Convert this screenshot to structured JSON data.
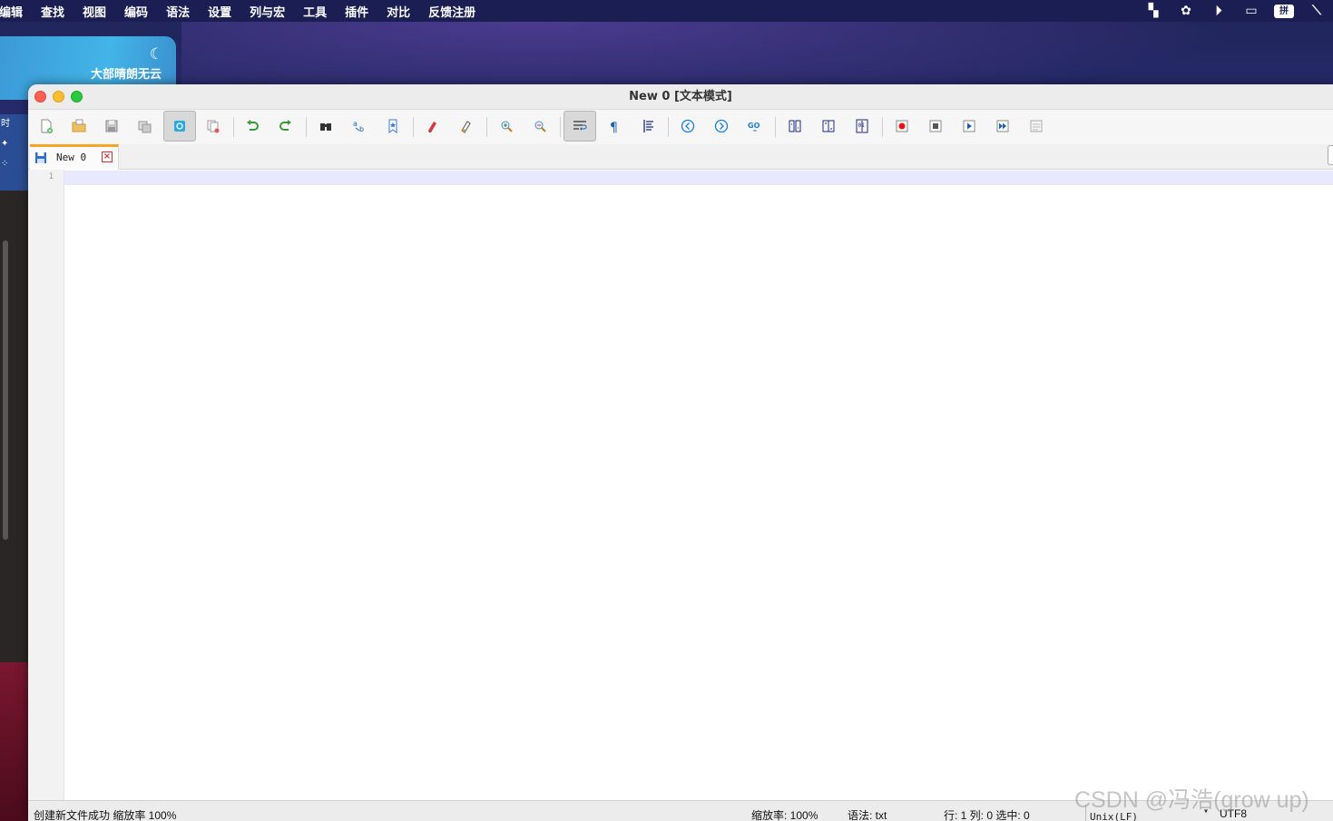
{
  "menubar": {
    "items": [
      "编辑",
      "查找",
      "视图",
      "编码",
      "语法",
      "设置",
      "列与宏",
      "工具",
      "插件",
      "对比",
      "反馈注册"
    ],
    "ime_label": "拼"
  },
  "weather": {
    "description": "大部晴朗无云"
  },
  "desktop": {
    "left_label": "时"
  },
  "window": {
    "title": "New 0 [文本模式]"
  },
  "toolbar": {
    "buttons": [
      "new-file",
      "open-file",
      "save",
      "save-all",
      "reload",
      "close-all",
      "undo",
      "redo",
      "find",
      "replace",
      "bookmark",
      "mark",
      "clear-mark",
      "zoom-in",
      "zoom-out",
      "word-wrap",
      "show-symbols",
      "indent-guide",
      "nav-back",
      "nav-forward",
      "goto",
      "split-horizontal",
      "split-vertical",
      "sync-scroll",
      "record-macro",
      "stop-macro",
      "play-macro",
      "run-macro-multiple",
      "save-macro"
    ],
    "active": [
      "reload",
      "word-wrap"
    ]
  },
  "tabs": [
    {
      "label": "New 0"
    }
  ],
  "editor": {
    "line_numbers": [
      "1"
    ]
  },
  "statusbar": {
    "message": "创建新文件成功 缩放率 100%",
    "zoom": "缩放率: 100%",
    "syntax": "语法:  txt",
    "position": "行: 1 列: 0 选中: 0",
    "eol": "Unix(LF)",
    "encoding": "UTF8"
  },
  "watermark": "CSDN @冯浩(grow up)"
}
